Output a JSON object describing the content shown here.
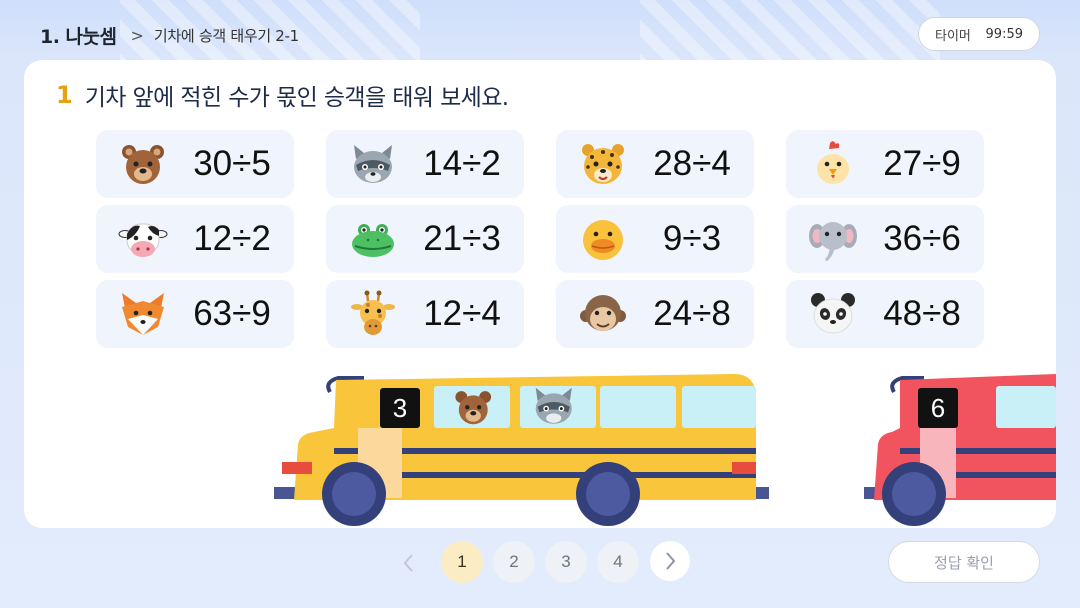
{
  "header": {
    "title": "1. 나눗셈",
    "separator": ">",
    "subtitle": "기차에 승객 태우기 2-1"
  },
  "timer": {
    "label": "타이머",
    "value": "99:59"
  },
  "question": {
    "number": "1",
    "text": "기차 앞에 적힌 수가 몫인 승객을 태워 보세요."
  },
  "tiles": [
    {
      "animal": "bear-icon",
      "expr": "30÷5"
    },
    {
      "animal": "raccoon-icon",
      "expr": "14÷2"
    },
    {
      "animal": "leopard-icon",
      "expr": "28÷4"
    },
    {
      "animal": "chick-icon",
      "expr": "27÷9"
    },
    {
      "animal": "cow-icon",
      "expr": "12÷2"
    },
    {
      "animal": "crocodile-icon",
      "expr": "21÷3"
    },
    {
      "animal": "duck-icon",
      "expr": "9÷3"
    },
    {
      "animal": "elephant-icon",
      "expr": "36÷6"
    },
    {
      "animal": "fox-icon",
      "expr": "63÷9"
    },
    {
      "animal": "giraffe-icon",
      "expr": "12÷4"
    },
    {
      "animal": "monkey-icon",
      "expr": "24÷8"
    },
    {
      "animal": "panda-icon",
      "expr": "48÷8"
    }
  ],
  "buses": [
    {
      "number": "3",
      "color": "#f9c53a",
      "passengers": [
        "bear-icon",
        "raccoon-icon"
      ]
    },
    {
      "number": "6",
      "color": "#f2545f",
      "passengers": []
    }
  ],
  "pager": {
    "pages": [
      "1",
      "2",
      "3",
      "4"
    ],
    "active": "1"
  },
  "confirm_label": "정답 확인",
  "colors": {
    "accent": "#e6a114",
    "background": "#dfe9fb",
    "tile": "#f0f5fd",
    "active_page": "#fbecc3"
  }
}
